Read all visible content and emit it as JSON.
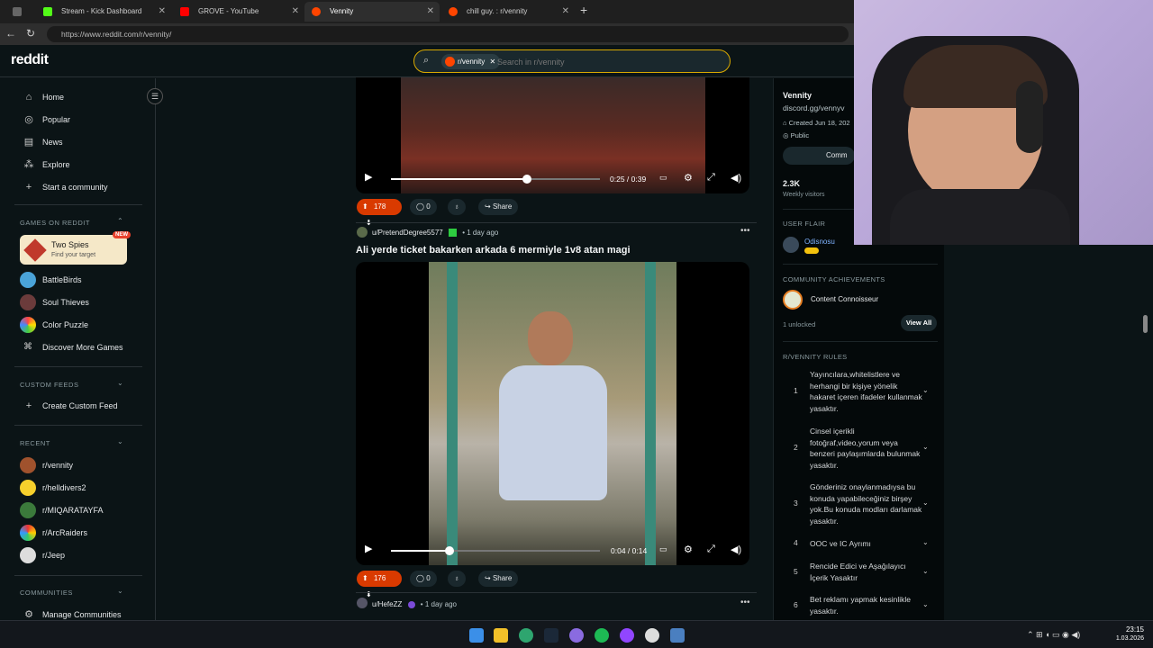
{
  "browser": {
    "tabs": [
      {
        "title": "Stream - Kick Dashboard",
        "favicon_color": "#53fc18"
      },
      {
        "title": "GROVE - YouTube",
        "favicon_color": "#ff0000"
      },
      {
        "title": "Vennity",
        "favicon_color": "#ff4500"
      },
      {
        "title": "chill guy. : r/vennity",
        "favicon_color": "#ff4500"
      }
    ],
    "url": "https://www.reddit.com/r/vennity/"
  },
  "header": {
    "logo": "reddit",
    "search_chip": "r/vennity",
    "search_placeholder": "Search in r/vennity"
  },
  "sidebar": {
    "nav": [
      {
        "label": "Home",
        "icon": "home-icon"
      },
      {
        "label": "Popular",
        "icon": "popular-icon"
      },
      {
        "label": "News",
        "icon": "news-icon"
      },
      {
        "label": "Explore",
        "icon": "explore-icon"
      },
      {
        "label": "Start a community",
        "icon": "plus-icon"
      }
    ],
    "games_header": "GAMES ON REDDIT",
    "featured_game": {
      "title": "Two Spies",
      "subtitle": "Find your target",
      "badge": "NEW"
    },
    "games": [
      "BattleBirds",
      "Soul Thieves",
      "Color Puzzle",
      "Discover More Games"
    ],
    "custom_feeds_header": "CUSTOM FEEDS",
    "create_feed": "Create Custom Feed",
    "recent_header": "RECENT",
    "recent": [
      "r/vennity",
      "r/helldivers2",
      "r/MIQARATAYFA",
      "r/ArcRaiders",
      "r/Jeep"
    ],
    "communities_header": "COMMUNITIES",
    "manage": "Manage Communities"
  },
  "posts": [
    {
      "time": "0:25 / 0:39",
      "progress": 0.65,
      "votes": "178",
      "comments": "0",
      "share": "Share"
    },
    {
      "author": "u/PretendDegree5577",
      "age": "1 day ago",
      "title": "Ali yerde ticket bakarken arkada 6 mermiyle 1v8 atan magi",
      "time": "0:04 / 0:14",
      "progress": 0.28,
      "votes": "176",
      "comments": "0",
      "share": "Share"
    },
    {
      "author": "u/HefeZZ",
      "age": "1 day ago"
    }
  ],
  "right": {
    "name": "Vennity",
    "link": "discord.gg/vennyv",
    "created": "Created Jun 18, 202",
    "visibility": "Public",
    "community_button": "Comm",
    "visitors": "2.3K",
    "visitors_label": "Weekly visitors",
    "flair_header": "USER FLAIR",
    "flair_name": "Odisnosu",
    "achievements_header": "COMMUNITY ACHIEVEMENTS",
    "achievement": "Content Connoisseur",
    "unlocked": "1 unlocked",
    "view_all": "View All",
    "rules_header": "R/VENNITY RULES",
    "rules": [
      {
        "n": "1",
        "text": "Yayıncılara,whitelistlere ve herhangi bir kişiye yönelik hakaret içeren ifadeler kullanmak yasaktır."
      },
      {
        "n": "2",
        "text": "Cinsel içerikli fotoğraf,video,yorum veya benzeri paylaşımlarda bulunmak yasaktır."
      },
      {
        "n": "3",
        "text": "Gönderiniz onaylanmadıysa bu konuda yapabileceğiniz birşey yok.Bu konuda modları darlamak yasaktır."
      },
      {
        "n": "4",
        "text": "OOC ve IC Ayrımı"
      },
      {
        "n": "5",
        "text": "Rencide Edici ve Aşağılayıcı İçerik Yasaktır"
      },
      {
        "n": "6",
        "text": "Bet reklamı yapmak kesinlikle yasaktır."
      }
    ]
  },
  "taskbar": {
    "time": "23:15",
    "date": "1.03.2026"
  }
}
